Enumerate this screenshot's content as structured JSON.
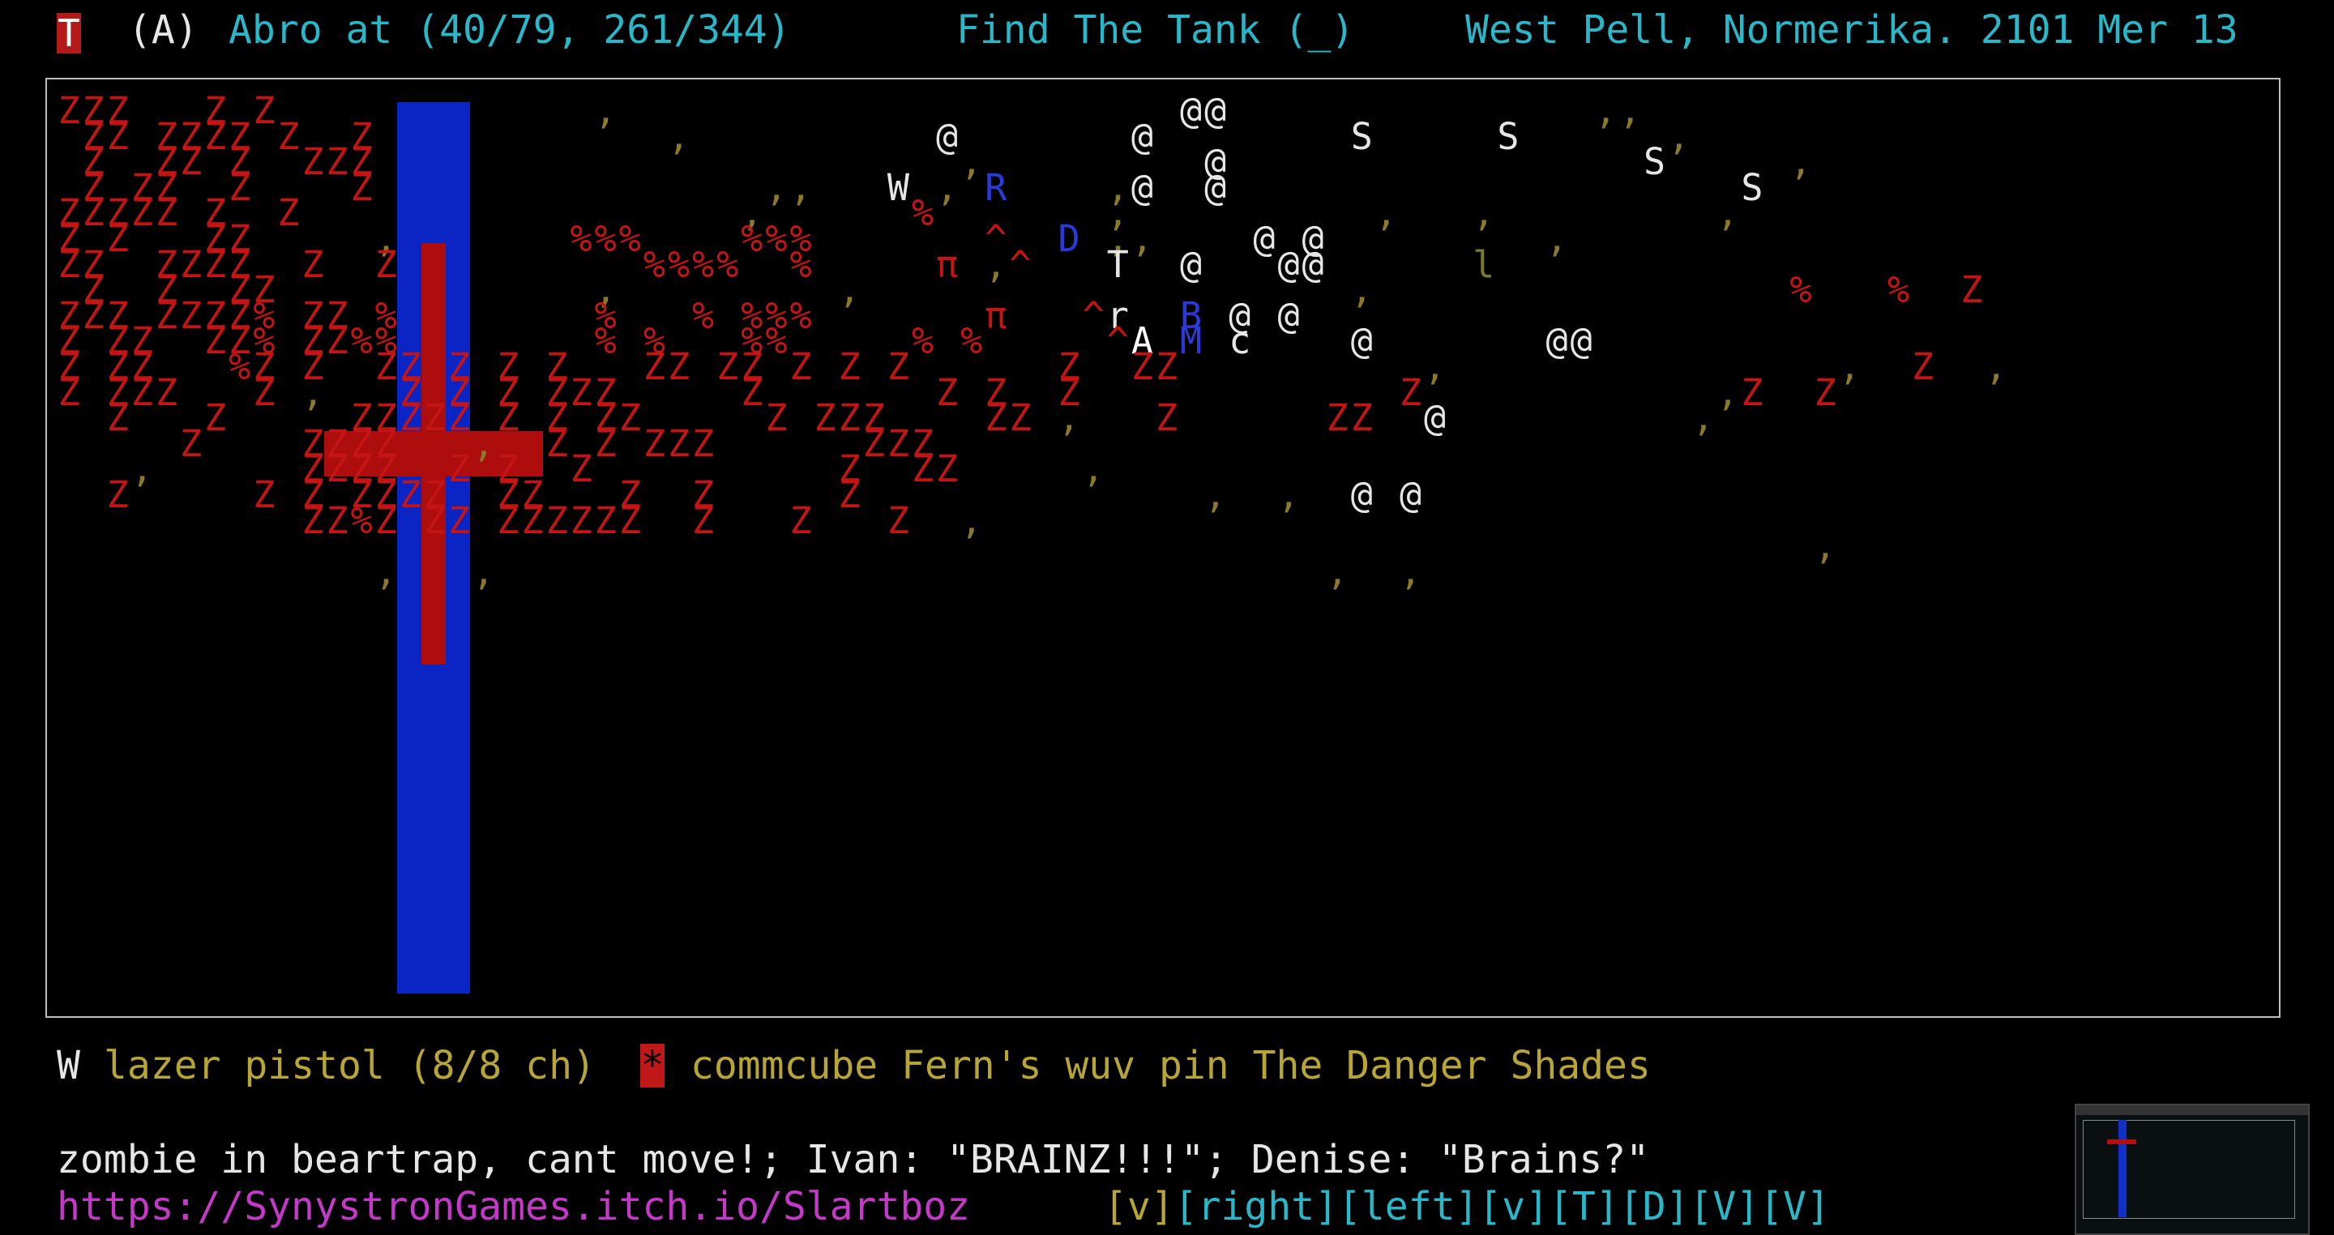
{
  "status_bar": {
    "player_glyph": "T",
    "player_mode": "(A)",
    "location_text": "Abro at (40/79, 261/344)",
    "quest": "Find The Tank (_)",
    "place_date": "West Pell, Normerika. 2101 Mer 13"
  },
  "inventory": {
    "slot_letter": "W",
    "weapon": "lazer pistol (8/8 ch)",
    "item_icon": "*",
    "items": "commcube Fern's wuv pin The Danger Shades"
  },
  "messages": {
    "log": "zombie in beartrap, cant move!; Ivan: \"BRAINZ!!!\"; Denise: \"Brains?\"",
    "url": "https://SynystronGames.itch.io/Slartboz",
    "keys": [
      {
        "label": "[v]"
      },
      {
        "label": "[right]"
      },
      {
        "label": "[left]"
      },
      {
        "label": "[v]"
      },
      {
        "label": "[T]"
      },
      {
        "label": "[D]"
      },
      {
        "label": "[V]"
      },
      {
        "label": "[V]"
      }
    ]
  },
  "map": {
    "rows": [
      "ZZZ   Z Z             ,                       @@               ,,",
      " ZZ ZZZZ Z  Z            ,          @       @        S     S      ,",
      " Z  ZZ Z  ZZZ                        ,         @                 S     ,",
      " Z ZZ  Z    Z                ,,   W , R    ,@  @                     S",
      "ZZZZZ Z  Z                  ,      %       ,          ,   ,         ,",
      "Z Z   ZZ     ,       %%%    %%%       ^  D ,,    @ @         ,",
      "ZZ  ZZZZ  Z  Z          %%%%  %     π ,^   T  @   @@      l",
      " Z  Z  ZZ             ,         ,                    ,                 %   %  Z",
      "ZZZ ZZZZ% ZZ %        %   % %%%       π   ^r  B @ @",
      "Z ZZ  ZZ% ZZ%%        % %   %%     % %     ^A M c    @       @@",
      "Z ZZ   %Z Z  ZZ Z Z Z   ZZ ZZ Z Z Z      Z  ZZ          ,                ,  Z  ,",
      "Z ZZZ   Z ,   Z Z Z ZZZ     Z       Z Z  Z             Z            ,Z  Z",
      "  Z   Z     ZZZZZ Z Z ZZ     Z ZZZ    ZZ ,   Z      ZZ  @          ,",
      "     Z    ZZZZ   ,  Z Z ZZZ      ZZZ",
      "   ,      ZZZZ  Z Z  Z          Z  ZZ     ,",
      "  Z     Z Z ZZZZ  ZZ   Z  Z     Z              ,  ,  @ @",
      "          ZZ%Z ZZ ZZZZZZ  Z   Z   Z  ,",
      "                                                                        ,",
      "             ,   ,                                  ,  ,"
    ],
    "palette": {
      "Z": "#c41414",
      "%": "#c41414",
      "@": "#e6e6e6",
      "S": "#e6e6e6",
      ",": "#8a7a2a",
      "W": "#e6e6e6",
      "R": "#2a3ad8",
      "D": "#2a3ad8",
      "B": "#2a3ad8",
      "M": "#2a3ad8",
      "π": "#c41414",
      "^": "#c41414",
      "T": "#e6e6e6",
      "l": "#7a7a2a",
      "r": "#e6e6e6",
      "A": "#ffffff",
      "c": "#e6e6e6",
      "~": "#e6e6e6"
    }
  },
  "colors": {
    "crosshair_blue": "#0b25c4",
    "crosshair_red": "#ad0d0d",
    "status_cyan": "#29b8c9",
    "inventory_yellow": "#b7a636",
    "url_magenta": "#c538c9"
  }
}
